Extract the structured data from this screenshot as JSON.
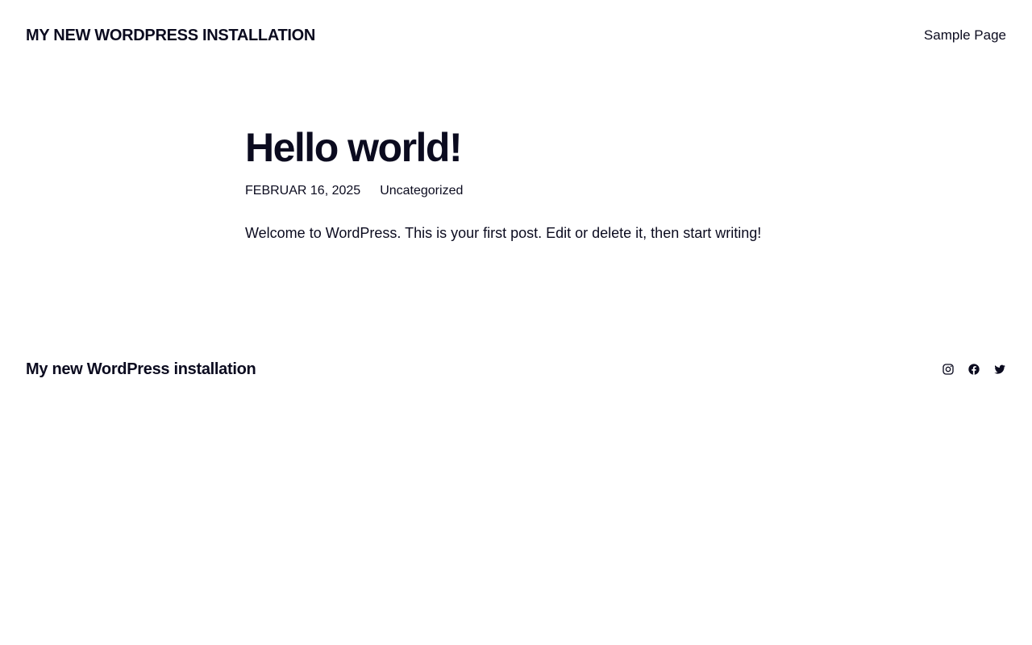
{
  "header": {
    "site_title": "MY NEW WORDPRESS INSTALLATION",
    "nav": [
      {
        "label": "Sample Page"
      }
    ]
  },
  "post": {
    "title": "Hello world!",
    "date": "FEBRUAR 16, 2025",
    "category": "Uncategorized",
    "content": "Welcome to WordPress. This is your first post. Edit or delete it, then start writing!"
  },
  "footer": {
    "site_title": "My new WordPress installation",
    "social": [
      {
        "icon": "instagram-icon"
      },
      {
        "icon": "facebook-icon"
      },
      {
        "icon": "twitter-icon"
      }
    ]
  },
  "colors": {
    "text": "#0b0b1f",
    "background": "#ffffff"
  }
}
